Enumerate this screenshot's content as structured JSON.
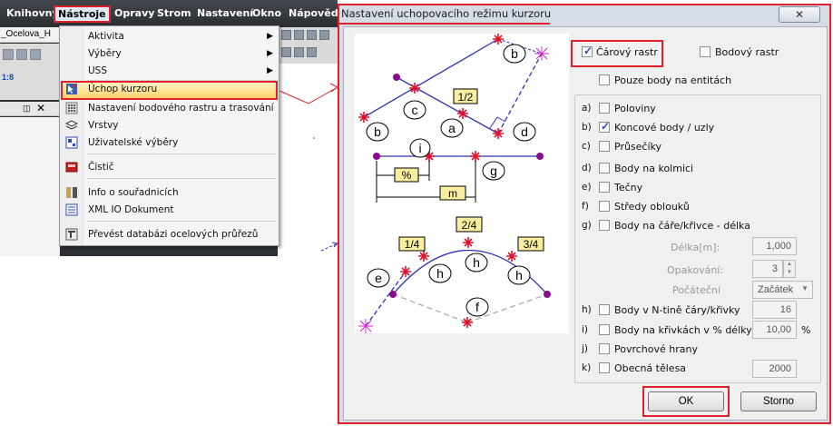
{
  "menubar": {
    "items": [
      "Knihovny",
      "Nástroje",
      "Opravy",
      "Strom",
      "Nastavení",
      "Okno",
      "Nápověda"
    ]
  },
  "document_tab": "_Ocelova_H",
  "toolbar": {
    "zoom": "1:8"
  },
  "dropdown": {
    "items": [
      {
        "label": "Aktivita",
        "submenu": true
      },
      {
        "label": "Výběry",
        "submenu": true
      },
      {
        "label": "USS",
        "submenu": true
      },
      {
        "label": "Úchop kurzoru",
        "highlighted": true
      },
      {
        "label": "Nastavení bodového rastru a trasování"
      },
      {
        "label": "Vrstvy"
      },
      {
        "label": "Uživatelské výběry"
      },
      {
        "label": "Čistič"
      },
      {
        "label": "Info o souřadnicích"
      },
      {
        "label": "XML IO Dokument"
      },
      {
        "label": "Převést databázi ocelových průřezů"
      }
    ],
    "submenu_arrow": "▶"
  },
  "dialog": {
    "title": "Nastavení uchopovacího režimu kurzoru",
    "close_glyph": "✕",
    "illustration": {
      "labels": [
        "b",
        "b",
        "c",
        "a",
        "d",
        "i",
        "g",
        "e",
        "h",
        "h",
        "h",
        "f"
      ],
      "boxes": [
        "1/2",
        "%",
        "m",
        "2/4",
        "1/4",
        "3/4"
      ]
    },
    "raster": {
      "line": {
        "label": "Čárový rastr",
        "checked": true
      },
      "point": {
        "label": "Bodový rastr",
        "checked": false
      }
    },
    "only_entity_points": {
      "label": "Pouze body na entitách",
      "checked": false
    },
    "options": [
      {
        "letter": "a)",
        "label": "Poloviny",
        "checked": false
      },
      {
        "letter": "b)",
        "label": "Koncové body / uzly",
        "checked": true
      },
      {
        "letter": "c)",
        "label": "Průsečíky",
        "checked": false
      },
      {
        "letter": "d)",
        "label": "Body na kolmici",
        "checked": false
      },
      {
        "letter": "e)",
        "label": "Tečny",
        "checked": false
      },
      {
        "letter": "f)",
        "label": "Středy oblouků",
        "checked": false
      },
      {
        "letter": "g)",
        "label": "Body na čáře/křivce - délka",
        "checked": false
      }
    ],
    "length_fields": {
      "length": {
        "label": "Délka[m]:",
        "value": "1,000"
      },
      "repeat": {
        "label": "Opakování:",
        "value": "3"
      },
      "start": {
        "label": "Počáteční",
        "value": "Začátek"
      }
    },
    "n_th": {
      "letter": "h)",
      "label": "Body v N-tině čáry/křivky",
      "checked": false,
      "value": "16"
    },
    "percent": {
      "letter": "i)",
      "label": "Body na křivkách v % délky",
      "checked": false,
      "value": "10,00",
      "unit": "%"
    },
    "surface_edges": {
      "letter": "j)",
      "label": "Povrchové hrany",
      "checked": false
    },
    "general_solids": {
      "letter": "k)",
      "label": "Obecná tělesa",
      "checked": false,
      "value": "2000"
    },
    "buttons": {
      "ok": "OK",
      "cancel": "Storno"
    }
  },
  "colors": {
    "highlight": "#e0202a",
    "point": "#8a0a8a",
    "line": "#3030b0"
  }
}
